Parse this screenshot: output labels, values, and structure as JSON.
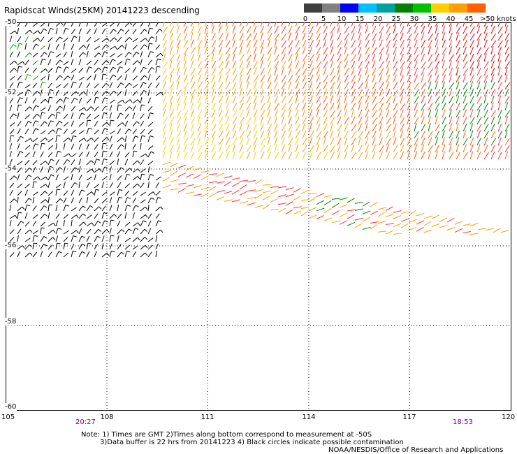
{
  "title": "Rapidscat Winds(25KM) 20141223 descending",
  "legend": {
    "colors": [
      "#404040",
      "#808080",
      "#0000ff",
      "#00c0ff",
      "#00a0a0",
      "#008000",
      "#00c000",
      "#ffd000",
      "#ffa000",
      "#ff6000",
      "#ff3030",
      "#e00000",
      "#804000",
      "#c06000",
      "#ff00ff",
      "#c000c0",
      "#8000c0",
      "#500080"
    ],
    "labels": [
      "0",
      "5",
      "10",
      "15",
      "20",
      "25",
      "30",
      "35",
      "40",
      "45",
      ">50 knots"
    ]
  },
  "map": {
    "lat_labels": [
      "-50",
      "-52",
      "-54",
      "-56",
      "-58",
      "-60"
    ],
    "lon_labels": [
      "105",
      "108",
      "111",
      "114",
      "117",
      "120"
    ],
    "times": [
      "20:27",
      "18:53"
    ]
  },
  "notes": {
    "line1": "Note: 1) Times are GMT 2)Times along bottom correspond to measurement at -50S",
    "line2": "3)Data buffer is 22 hrs from 20141223 4) Black circles indicate possible contamination",
    "credit": "NOAA/NESDIS/Office of Research and Applications"
  }
}
